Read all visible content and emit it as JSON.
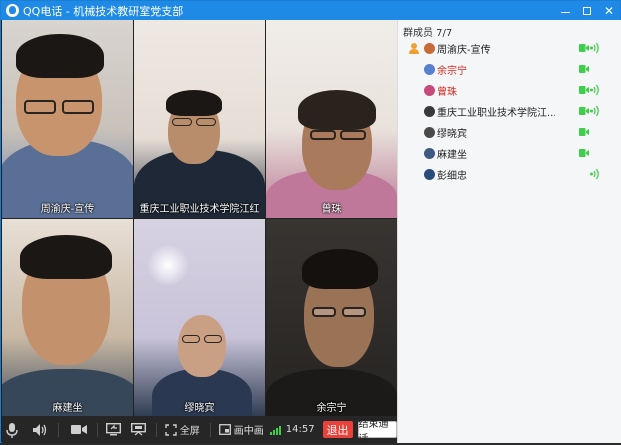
{
  "window": {
    "title": "QQ电话 - 机械技术教研室党支部"
  },
  "videos": [
    {
      "name": "周渝庆-宣传"
    },
    {
      "name": "重庆工业职业技术学院江红"
    },
    {
      "name": "曾珠"
    },
    {
      "name": "麻建坐"
    },
    {
      "name": "缪晓宾"
    },
    {
      "name": "余宗宁"
    }
  ],
  "toolbar": {
    "fullscreen_label": "全屏",
    "pip_label": "画中画",
    "time": "14:57",
    "exit_label": "退出",
    "end_call_label": "结束通话"
  },
  "sidebar": {
    "title": "群成员 7/7",
    "members": [
      {
        "name": "周渝庆-宣传",
        "camera": true,
        "audio": true,
        "host": true,
        "avatar_color": "#c76b3a"
      },
      {
        "name": "余宗宁",
        "camera": true,
        "audio": false,
        "highlight": true,
        "avatar_color": "#5a7fd0"
      },
      {
        "name": "曾珠",
        "camera": true,
        "audio": true,
        "highlight": true,
        "avatar_color": "#c74a7a"
      },
      {
        "name": "重庆工业职业技术学院江...",
        "camera": true,
        "audio": true,
        "avatar_color": "#3a3a3a"
      },
      {
        "name": "缪晓宾",
        "camera": true,
        "audio": false,
        "avatar_color": "#4a4a4a"
      },
      {
        "name": "麻建坐",
        "camera": true,
        "audio": false,
        "avatar_color": "#3e5a80"
      },
      {
        "name": "彭细忠",
        "camera": false,
        "audio": true,
        "avatar_color": "#2a4a7a"
      }
    ]
  },
  "colors": {
    "titlebar": "#1e8ae6",
    "active_green": "#3ecf4a",
    "exit_red": "#e8403a",
    "highlight_name": "#d9261c"
  }
}
